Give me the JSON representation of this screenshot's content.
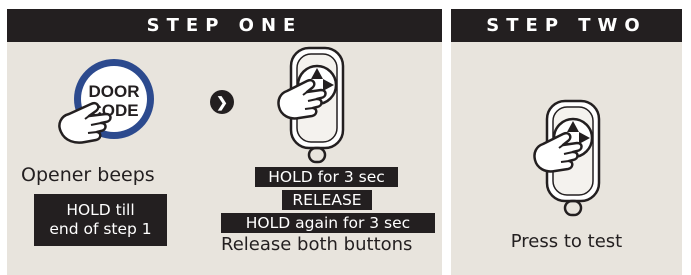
{
  "colors": {
    "panel_bg": "#e8e4dd",
    "dark": "#231f20",
    "ring_blue": "#2c4a8e",
    "hand_outline": "#231f20"
  },
  "step_one": {
    "title": "STEP ONE",
    "door_code_label": [
      "DOOR",
      "CODE"
    ],
    "arrow_icon": "chevron-right-icon",
    "caption_beeps": "Opener beeps",
    "hold_till_label": [
      "HOLD till",
      "end of step 1"
    ],
    "instructions": {
      "hold_3sec": "HOLD for 3 sec",
      "release": "RELEASE",
      "hold_again": "HOLD again for 3 sec",
      "release_both": "Release both buttons"
    }
  },
  "step_two": {
    "title": "STEP TWO",
    "caption": "Press to test"
  }
}
